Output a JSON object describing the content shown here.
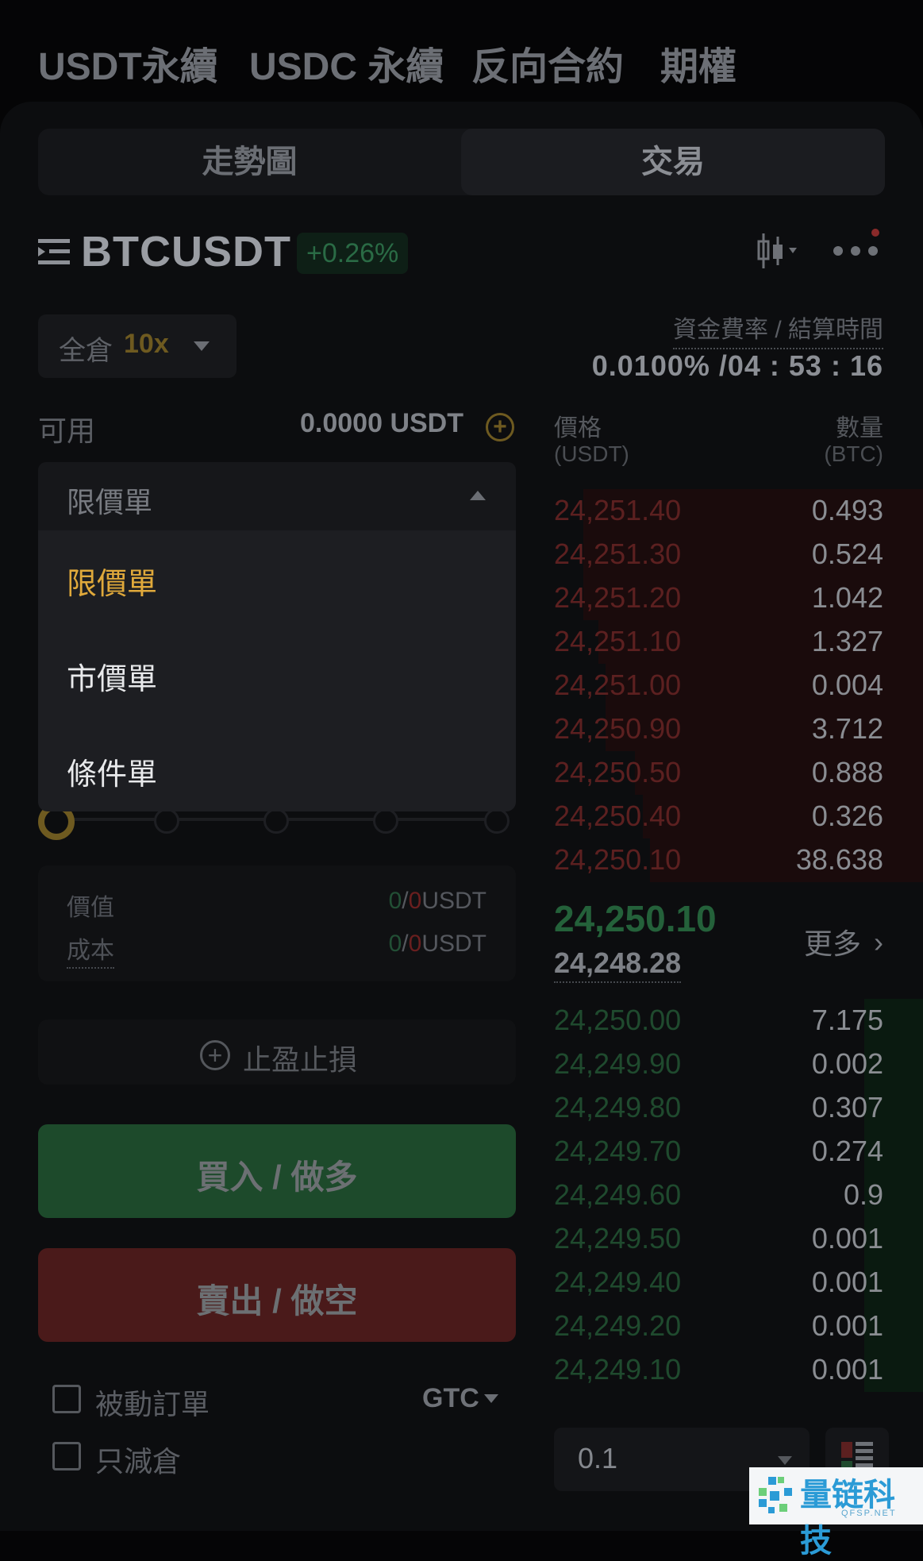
{
  "top_tabs": [
    "USDT永續",
    "USDC 永續",
    "反向合約",
    "期權"
  ],
  "segment": {
    "chart": "走勢圖",
    "trade": "交易"
  },
  "symbol": {
    "name": "BTCUSDT",
    "change": "+0.26%"
  },
  "margin": {
    "mode": "全倉",
    "leverage": "10x"
  },
  "funding": {
    "label": "資金費率 / 結算時間",
    "value": "0.0100% /04 : 53 : 16"
  },
  "available": {
    "label": "可用",
    "value": "0.0000 USDT"
  },
  "order_type": {
    "selected": "限價單",
    "options": [
      "限價單",
      "市價單",
      "條件單"
    ]
  },
  "slider": {
    "level": 0
  },
  "value_box": {
    "value_label": "價值",
    "cost_label": "成本",
    "green": "0",
    "sep": "/",
    "red": "0",
    "unit": "USDT"
  },
  "tpsl": {
    "label": "止盈止損"
  },
  "buy": {
    "label": "買入 / 做多"
  },
  "sell": {
    "label": "賣出 / 做空"
  },
  "options": {
    "post_only": "被動訂單",
    "reduce_only": "只減倉",
    "tif": "GTC"
  },
  "orderbook": {
    "price_header": "價格",
    "price_unit": "(USDT)",
    "qty_header": "數量",
    "qty_unit": "(BTC)",
    "asks": [
      {
        "price": "24,251.40",
        "qty": "0.493",
        "depth": 0.92
      },
      {
        "price": "24,251.30",
        "qty": "0.524",
        "depth": 0.92
      },
      {
        "price": "24,251.20",
        "qty": "1.042",
        "depth": 0.92
      },
      {
        "price": "24,251.10",
        "qty": "1.327",
        "depth": 0.88
      },
      {
        "price": "24,251.00",
        "qty": "0.004",
        "depth": 0.86
      },
      {
        "price": "24,250.90",
        "qty": "3.712",
        "depth": 0.86
      },
      {
        "price": "24,250.50",
        "qty": "0.888",
        "depth": 0.78
      },
      {
        "price": "24,250.40",
        "qty": "0.326",
        "depth": 0.76
      },
      {
        "price": "24,250.10",
        "qty": "38.638",
        "depth": 0.74
      }
    ],
    "last_price": "24,250.10",
    "mark_price": "24,248.28",
    "more": "更多",
    "bids": [
      {
        "price": "24,250.00",
        "qty": "7.175",
        "depth": 0.16
      },
      {
        "price": "24,249.90",
        "qty": "0.002",
        "depth": 0.16
      },
      {
        "price": "24,249.80",
        "qty": "0.307",
        "depth": 0.16
      },
      {
        "price": "24,249.70",
        "qty": "0.274",
        "depth": 0.16
      },
      {
        "price": "24,249.60",
        "qty": "0.9",
        "depth": 0.16
      },
      {
        "price": "24,249.50",
        "qty": "0.001",
        "depth": 0.16
      },
      {
        "price": "24,249.40",
        "qty": "0.001",
        "depth": 0.16
      },
      {
        "price": "24,249.20",
        "qty": "0.001",
        "depth": 0.16
      },
      {
        "price": "24,249.10",
        "qty": "0.001",
        "depth": 0.16
      }
    ],
    "precision": "0.1"
  },
  "watermark": {
    "text": "量链科技",
    "sub": "QFSP.NET"
  },
  "colors": {
    "accent": "#e0a93b",
    "buy": "#1d4a2b",
    "sell": "#4a1a1a"
  }
}
